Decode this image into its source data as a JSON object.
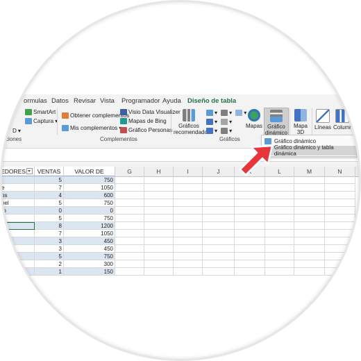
{
  "menu": {
    "tabs": [
      "ormulas",
      "Datos",
      "Revisar",
      "Vista",
      "Programador",
      "Ayuda",
      "Diseño de tabla"
    ]
  },
  "ribbon": {
    "smartart": "SmartArt",
    "captura": "Captura",
    "d_label": "D",
    "obtener": "Obtener complementos",
    "mis": "Mis complementos",
    "visio": "Visio Data Visualizer",
    "bing": "Mapas de Bing",
    "personas": "Gráfico Personas",
    "recomendados": "Gráficos recomendados",
    "mapas": "Mapas",
    "dinamico": "Gráfico dinámico",
    "mapa3d": "Mapa 3D",
    "lineas": "Líneas",
    "columna": "Column",
    "groups": {
      "ilustraciones": "ciones",
      "complementos": "Complementos",
      "graficos": "Gráficos"
    }
  },
  "dropdown": {
    "item1": "Gráfico dinámico",
    "item2": "Gráfico dinámico y tabla dinámica"
  },
  "columns": {
    "a": "EDORES",
    "b": "VENTAS",
    "c": "VALOR DE VENTAS",
    "g": "G",
    "h": "H",
    "i": "I",
    "j": "J",
    "k": "K",
    "l": "L",
    "m": "M",
    "n": "N"
  },
  "table": {
    "rows": [
      {
        "a": "",
        "b": "5",
        "c": "750"
      },
      {
        "a": "e",
        "b": "7",
        "c": "1050"
      },
      {
        "a": "os",
        "b": "4",
        "c": "600"
      },
      {
        "a": "uel",
        "b": "5",
        "c": "750"
      },
      {
        "a": "to",
        "b": "0",
        "c": "0"
      },
      {
        "a": "",
        "b": "5",
        "c": "750"
      },
      {
        "a": "e",
        "b": "8",
        "c": "1200"
      },
      {
        "a": "",
        "b": "7",
        "c": "1050"
      },
      {
        "a": "",
        "b": "3",
        "c": "450"
      },
      {
        "a": "",
        "b": "3",
        "c": "450"
      },
      {
        "a": "",
        "b": "5",
        "c": "750"
      },
      {
        "a": "",
        "b": "2",
        "c": "300"
      },
      {
        "a": "",
        "b": "1",
        "c": "150"
      }
    ]
  },
  "colors": {
    "accent": "#217346",
    "band": "#dce6f1",
    "arrow": "#e8343b"
  }
}
